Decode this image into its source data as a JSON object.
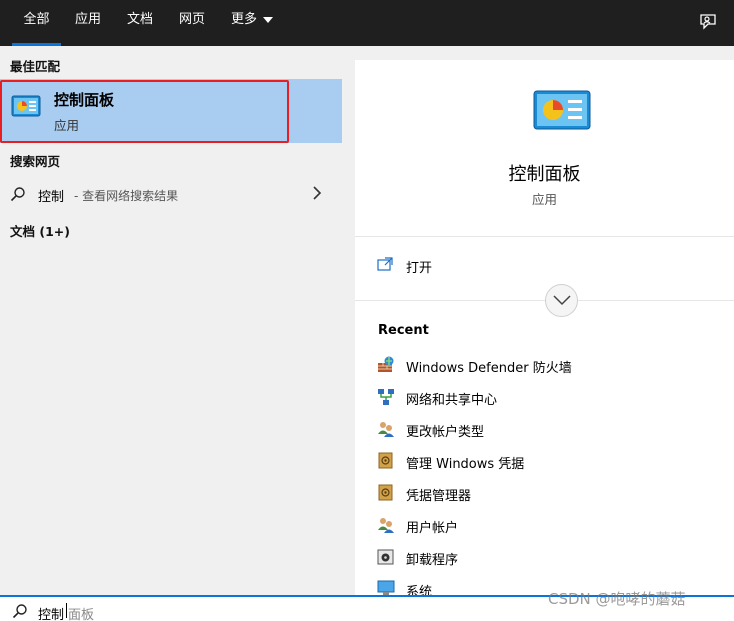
{
  "tabs": [
    {
      "label": "全部",
      "active": true
    },
    {
      "label": "应用"
    },
    {
      "label": "文档"
    },
    {
      "label": "网页"
    },
    {
      "label": "更多"
    }
  ],
  "left": {
    "best_match_heading": "最佳匹配",
    "best_match": {
      "title": "控制面板",
      "subtitle": "应用",
      "icon": "control-panel-icon"
    },
    "web_heading": "搜索网页",
    "web_result": {
      "query": "控制",
      "hint": " - 查看网络搜索结果"
    },
    "docs_heading": "文档 (1+)"
  },
  "right": {
    "title": "控制面板",
    "subtitle": "应用",
    "open_label": "打开",
    "recent_heading": "Recent",
    "recent_items": [
      {
        "label": "Windows Defender 防火墙",
        "icon": "firewall-icon"
      },
      {
        "label": "网络和共享中心",
        "icon": "network-icon"
      },
      {
        "label": "更改帐户类型",
        "icon": "users-icon"
      },
      {
        "label": "管理 Windows 凭据",
        "icon": "credential-icon"
      },
      {
        "label": "凭据管理器",
        "icon": "credential-icon"
      },
      {
        "label": "用户帐户",
        "icon": "users-icon"
      },
      {
        "label": "卸载程序",
        "icon": "programs-icon"
      },
      {
        "label": "系统",
        "icon": "system-icon"
      }
    ]
  },
  "search": {
    "typed": "控制",
    "suggestion": "面板"
  },
  "watermark": "CSDN @咆哮的蘑菇",
  "colors": {
    "accent": "#0a74d8",
    "selected_bg": "#a9cdf0",
    "highlight_outline": "#e81e22",
    "topbar_bg": "#1f1f1f"
  }
}
